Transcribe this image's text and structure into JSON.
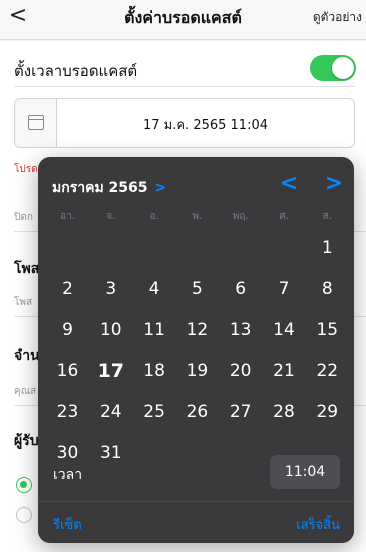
{
  "nav": {
    "back_icon": "chevron-left-icon",
    "back_glyph": "<",
    "title": "ตั้งค่าบรอดแคสต์",
    "action": "ดูตัวอย่าง"
  },
  "form": {
    "schedule_label": "ตั้งเวลาบรอดแคสต์",
    "schedule_enabled": true,
    "date_value": "17 ม.ค. 2565 11:04",
    "note_red": "โปรด",
    "partial": [
      "ปิดก",
      "โพส",
      "โพส",
      "จำน",
      "คุณส",
      "ผู้รับ"
    ]
  },
  "calendar": {
    "month_title": "มกราคม 2565",
    "month_chevron": ">",
    "prev_glyph": "<",
    "next_glyph": ">",
    "weekdays": [
      "อา.",
      "จ.",
      "อ.",
      "พ.",
      "พฤ.",
      "ศ.",
      "ส."
    ],
    "first_weekday_index": 6,
    "days_in_month": 31,
    "selected_day": 17,
    "time_label": "เวลา",
    "time_value": "11:04",
    "reset_label": "รีเซ็ต",
    "done_label": "เสร็จสิ้น",
    "accent": "#0a84ff"
  },
  "colors": {
    "toggle_on": "#34c759",
    "picker_bg": "#3a3a3c",
    "warning": "#e0332f"
  }
}
